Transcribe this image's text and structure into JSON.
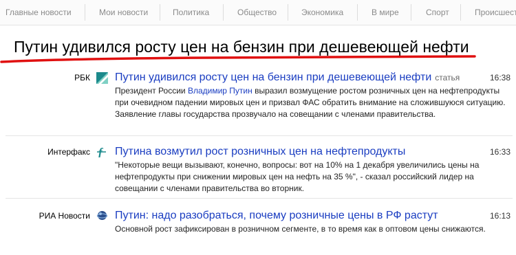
{
  "nav": {
    "items": [
      "Главные новости",
      "Мои новости",
      "Политика",
      "Общество",
      "Экономика",
      "В мире",
      "Спорт",
      "Происшествия"
    ]
  },
  "headline": "Путин удивился росту цен на бензин при дешевеющей нефти",
  "colors": {
    "link": "#1a3dc1",
    "underline": "#e01010"
  },
  "news": [
    {
      "source": "РБК",
      "icon": "rbc-logo-icon",
      "title": "Путин удивился росту цен на бензин при дешевеющей нефти",
      "kind": "статья",
      "time": "16:38",
      "snippet_pre": "Президент России ",
      "snippet_person": "Владимир Путин",
      "snippet_post": " выразил возмущение ростом розничных цен на нефтепродукты при очевидном падении мировых цен и призвал ФАС обратить внимание на сложившуюся ситуацию. Заявление главы государства прозвучало на совещании с членами правительства."
    },
    {
      "source": "Интерфакс",
      "icon": "interfax-logo-icon",
      "title": "Путина возмутил рост розничных цен на нефтепродукты",
      "time": "16:33",
      "snippet": "\"Некоторые вещи вызывают, конечно, вопросы: вот на 10% на 1 декабря увеличились цены на нефтепродукты при снижении мировых цен на нефть на 35 %\", - сказал российский лидер на совещании с членами правительства во вторник."
    },
    {
      "source": "РИА Новости",
      "icon": "ria-logo-icon",
      "title": "Путин: надо разобраться, почему розничные цены в РФ растут",
      "time": "16:13",
      "snippet": "Основной рост зафиксирован в розничном сегменте, в то время как в оптовом цены снижаются."
    }
  ]
}
